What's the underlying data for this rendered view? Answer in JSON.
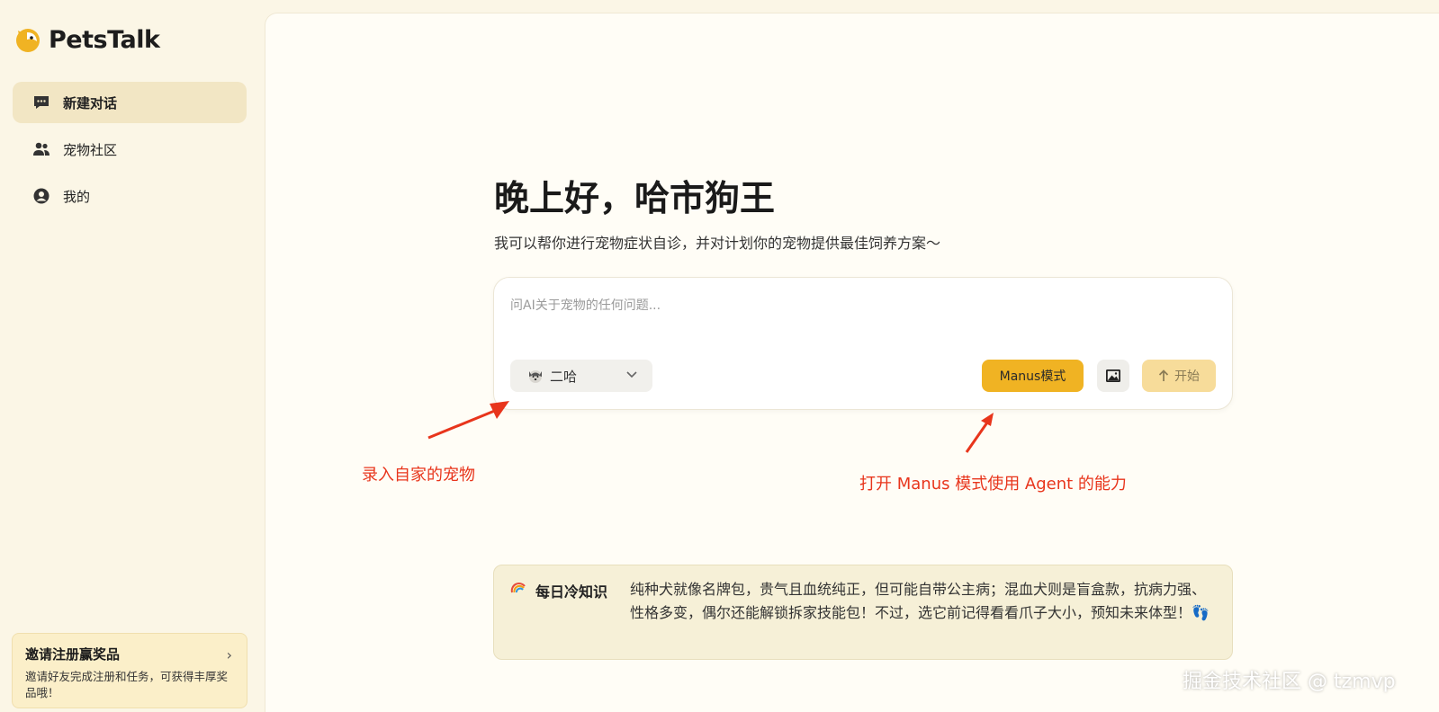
{
  "app": {
    "name": "PetsTalk"
  },
  "sidebar": {
    "items": [
      {
        "label": "新建对话",
        "icon": "chat-bubble-icon"
      },
      {
        "label": "宠物社区",
        "icon": "users-icon"
      },
      {
        "label": "我的",
        "icon": "user-circle-icon"
      }
    ],
    "invite": {
      "title": "邀请注册赢奖品",
      "description": "邀请好友完成注册和任务，可获得丰厚奖品哦！"
    }
  },
  "main": {
    "greeting": "晚上好，哈市狗王",
    "subtitle": "我可以帮你进行宠物症状自诊，并对计划你的宠物提供最佳饲养方案～",
    "input": {
      "placeholder": "问AI关于宠物的任何问题...",
      "value": ""
    },
    "pet_select": {
      "value": "二哈"
    },
    "manus_button": "Manus模式",
    "start_button": "开始",
    "daily_fact": {
      "label": "每日冷知识",
      "text": "纯种犬就像名牌包，贵气且血统纯正，但可能自带公主病；混血犬则是盲盒款，抗病力强、性格多变，偶尔还能解锁拆家技能包！不过，选它前记得看看爪子大小，预知未来体型！👣"
    }
  },
  "annotations": {
    "left": "录入自家的宠物",
    "right": "打开 Manus 模式使用 Agent 的能力"
  },
  "watermark": "掘金技术社区 @ tzmvp",
  "colors": {
    "background": "#fbf6e6",
    "accent": "#f0b323",
    "annotation": "#e8351c"
  }
}
